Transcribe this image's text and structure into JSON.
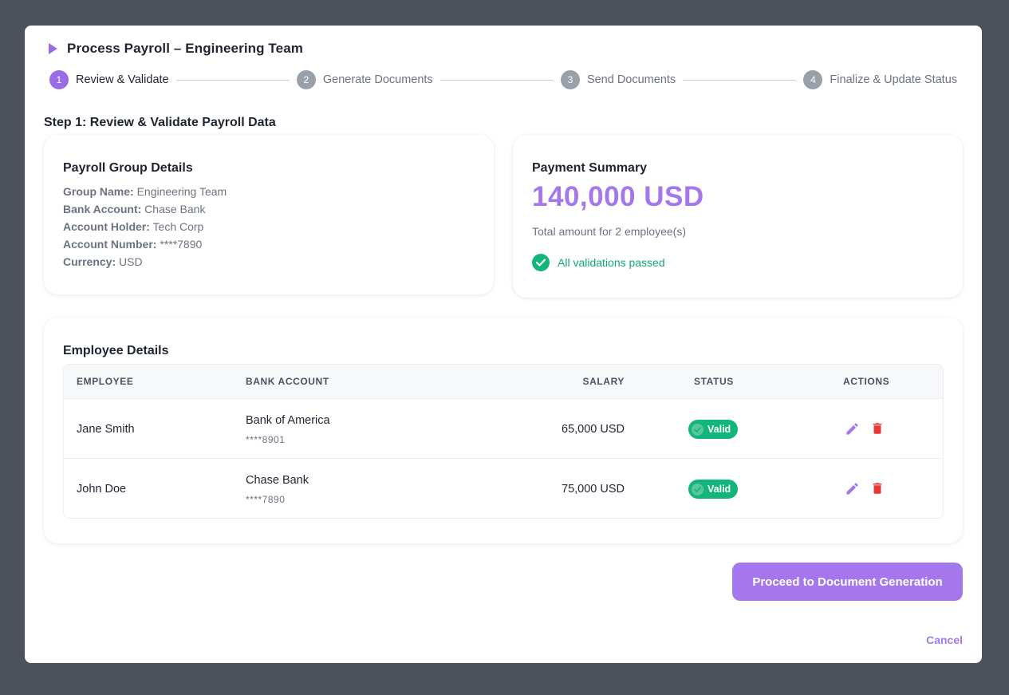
{
  "modal": {
    "title": "Process Payroll – Engineering Team"
  },
  "stepper": [
    {
      "number": "1",
      "label": "Review & Validate",
      "active": true
    },
    {
      "number": "2",
      "label": "Generate Documents",
      "active": false
    },
    {
      "number": "3",
      "label": "Send Documents",
      "active": false
    },
    {
      "number": "4",
      "label": "Finalize & Update Status",
      "active": false
    }
  ],
  "section_title": "Step 1: Review & Validate Payroll Data",
  "group_details": {
    "title": "Payroll Group Details",
    "rows": [
      {
        "key": "Group Name:",
        "value": "Engineering Team"
      },
      {
        "key": "Bank Account:",
        "value": "Chase Bank"
      },
      {
        "key": "Account Holder:",
        "value": "Tech Corp"
      },
      {
        "key": "Account Number:",
        "value": "****7890"
      },
      {
        "key": "Currency:",
        "value": "USD"
      }
    ]
  },
  "payment_summary": {
    "title": "Payment Summary",
    "amount": "140,000 USD",
    "total_text": "Total amount for 2 employee(s)",
    "validation_text": "All validations passed"
  },
  "employees": {
    "title": "Employee Details",
    "columns": {
      "employee": "EMPLOYEE",
      "bank_account": "BANK ACCOUNT",
      "salary": "SALARY",
      "status": "STATUS",
      "actions": "ACTIONS"
    },
    "rows": [
      {
        "name": "Jane Smith",
        "bank": "Bank of America",
        "account": "****8901",
        "salary": "65,000 USD",
        "status": "Valid"
      },
      {
        "name": "John Doe",
        "bank": "Chase Bank",
        "account": "****7890",
        "salary": "75,000 USD",
        "status": "Valid"
      }
    ]
  },
  "buttons": {
    "proceed": "Proceed to Document Generation",
    "cancel": "Cancel"
  },
  "colors": {
    "accent": "#a478ec",
    "success": "#12b57a",
    "danger": "#e53935",
    "overlay": "#4c525b"
  }
}
